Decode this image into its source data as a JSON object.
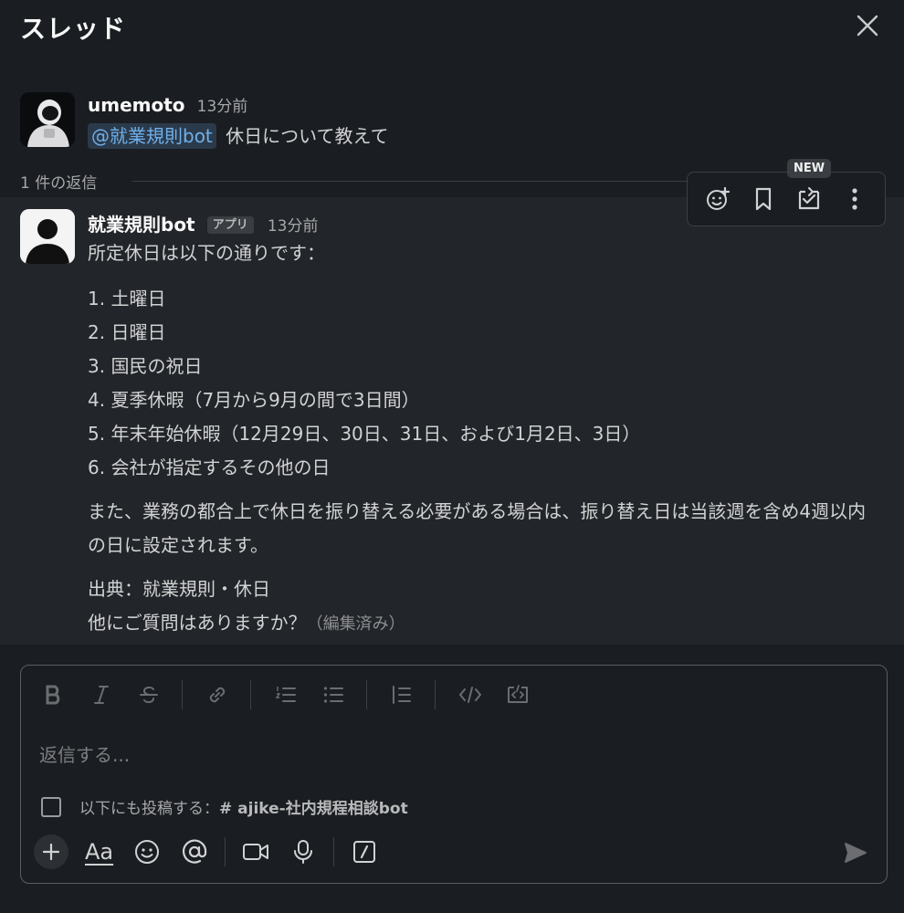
{
  "header": {
    "title": "スレッド"
  },
  "parent": {
    "author": "umemoto",
    "time": "13分前",
    "mention": "@就業規則bot",
    "text": "休日について教えて"
  },
  "reply_count": "1 件の返信",
  "reply": {
    "author": "就業規則bot",
    "badge": "アプリ",
    "time": "13分前",
    "intro": "所定休日は以下の通りです：",
    "list": [
      "1. 土曜日",
      "2. 日曜日",
      "3. 国民の祝日",
      "4. 夏季休暇（7月から9月の間で3日間）",
      "5. 年末年始休暇（12月29日、30日、31日、および1月2日、3日）",
      "6. 会社が指定するその他の日"
    ],
    "paragraph": "また、業務の都合上で休日を振り替える必要がある場合は、振り替え日は当該週を含め4週以内の日に設定されます。",
    "source": "出典：就業規則・休日",
    "question": "他にご質問はありますか？",
    "edited": "（編集済み）"
  },
  "actions": {
    "new_badge": "NEW"
  },
  "composer": {
    "placeholder": "返信する...",
    "also_post_prefix": "以下にも投稿する：",
    "channel": "# ajike-社内規程相談bot",
    "aa_label": "Aa"
  },
  "icons": {
    "close": "close-icon",
    "bold": "bold-icon",
    "italic": "italic-icon",
    "strike": "strikethrough-icon",
    "link": "link-icon",
    "ordered_list": "ordered-list-icon",
    "bullet_list": "bullet-list-icon",
    "blockquote": "blockquote-icon",
    "code": "code-icon",
    "code_block": "code-block-icon",
    "emoji_add": "add-reaction-icon",
    "bookmark": "bookmark-icon",
    "forward": "forward-icon",
    "more": "more-icon",
    "plus": "plus-icon",
    "format": "format-text-icon",
    "emoji": "emoji-icon",
    "mention": "mention-icon",
    "video": "video-icon",
    "mic": "microphone-icon",
    "slash": "slash-command-icon",
    "send": "send-icon"
  },
  "colors": {
    "background": "#1a1d21",
    "hover_block": "#222529",
    "mention": "#6fb0ea",
    "text": "#d1d2d3"
  }
}
